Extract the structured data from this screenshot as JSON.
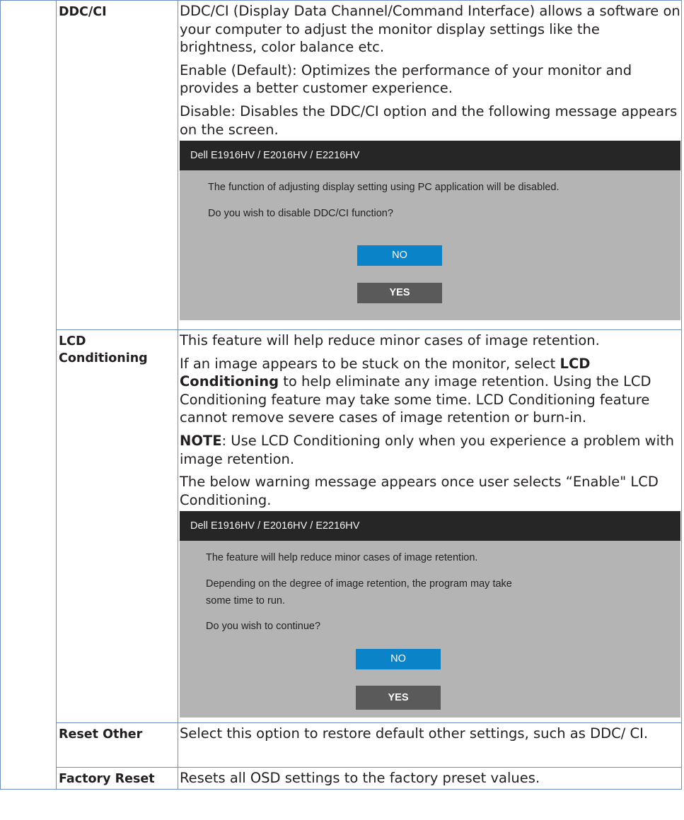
{
  "rows": [
    {
      "label": "DDC/CI",
      "paras": [
        "DDC/CI (Display Data Channel/Command Interface) allows a software on your computer to adjust the monitor display settings like the brightness, color balance etc.",
        "Enable (Default): Optimizes the performance of your monitor and provides a better customer experience.",
        "Disable: Disables the DDC/CI option and the following message appears on the screen."
      ],
      "dialog": {
        "title": "Dell E1916HV / E2016HV / E2216HV",
        "line1": "The function of adjusting display setting using PC application will be disabled.",
        "line2": "Do you wish to disable DDC/CI function?",
        "no": "NO",
        "yes": "YES"
      }
    },
    {
      "label": "LCD Conditioning",
      "p1": "This feature will help reduce minor cases of image retention.",
      "p2a": "If an image appears to be stuck on the monitor, select ",
      "p2b": "LCD Conditioning",
      "p2c": " to help eliminate any image retention. Using the LCD Conditioning feature may take some time. LCD Conditioning feature cannot remove  severe cases of image retention or burn-in.",
      "note_label": "NOTE",
      "note_text": ": Use LCD Conditioning only when you experience a problem with image retention.",
      "p4": "The below warning message appears once user selects “Enable\" LCD Conditioning.",
      "dialog": {
        "title": "Dell E1916HV / E2016HV / E2216HV",
        "line1": "The feature will help reduce minor cases of image retention.",
        "line2a": "Depending on the degree of image retention, the program may take",
        "line2b": "some time to run.",
        "line3": "Do you wish to continue?",
        "no": "NO",
        "yes": "YES"
      }
    },
    {
      "label": "Reset Other",
      "text": "Select this option to restore default other settings, such as DDC/ CI."
    },
    {
      "label": "Factory Reset",
      "text": "Resets all OSD settings to the factory preset values."
    }
  ]
}
